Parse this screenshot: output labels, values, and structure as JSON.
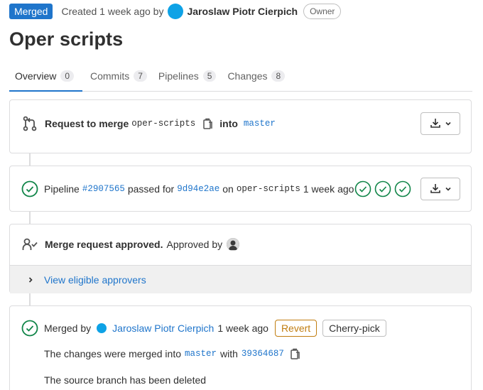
{
  "header": {
    "status_badge": "Merged",
    "created_text": "Created 1 week ago by",
    "author": "Jaroslaw Piotr Cierpich",
    "role": "Owner"
  },
  "title": "Oper scripts",
  "tabs": [
    {
      "label": "Overview",
      "count": "0"
    },
    {
      "label": "Commits",
      "count": "7"
    },
    {
      "label": "Pipelines",
      "count": "5"
    },
    {
      "label": "Changes",
      "count": "8"
    }
  ],
  "merge_request": {
    "prefix": "Request to merge",
    "source_branch": "oper-scripts",
    "into": "into",
    "target_branch": "master"
  },
  "pipeline": {
    "prefix": "Pipeline",
    "id": "#2907565",
    "passed_for": "passed for",
    "commit": "9d94e2ae",
    "on": "on",
    "branch": "oper-scripts",
    "time": "1 week ago",
    "stages_count": 3
  },
  "approval": {
    "strong": "Merge request approved.",
    "approved_by": "Approved by",
    "view_approvers": "View eligible approvers"
  },
  "merged": {
    "merged_by": "Merged by",
    "user": "Jaroslaw Piotr Cierpich",
    "time": "1 week ago",
    "revert_label": "Revert",
    "cherry_pick_label": "Cherry-pick",
    "changes_text": "The changes were merged into",
    "target_branch": "master",
    "with": "with",
    "commit": "39364687",
    "source_deleted": "The source branch has been deleted"
  },
  "colors": {
    "accent": "#1f75cb",
    "success": "#108548",
    "revert": "#c17d10"
  }
}
